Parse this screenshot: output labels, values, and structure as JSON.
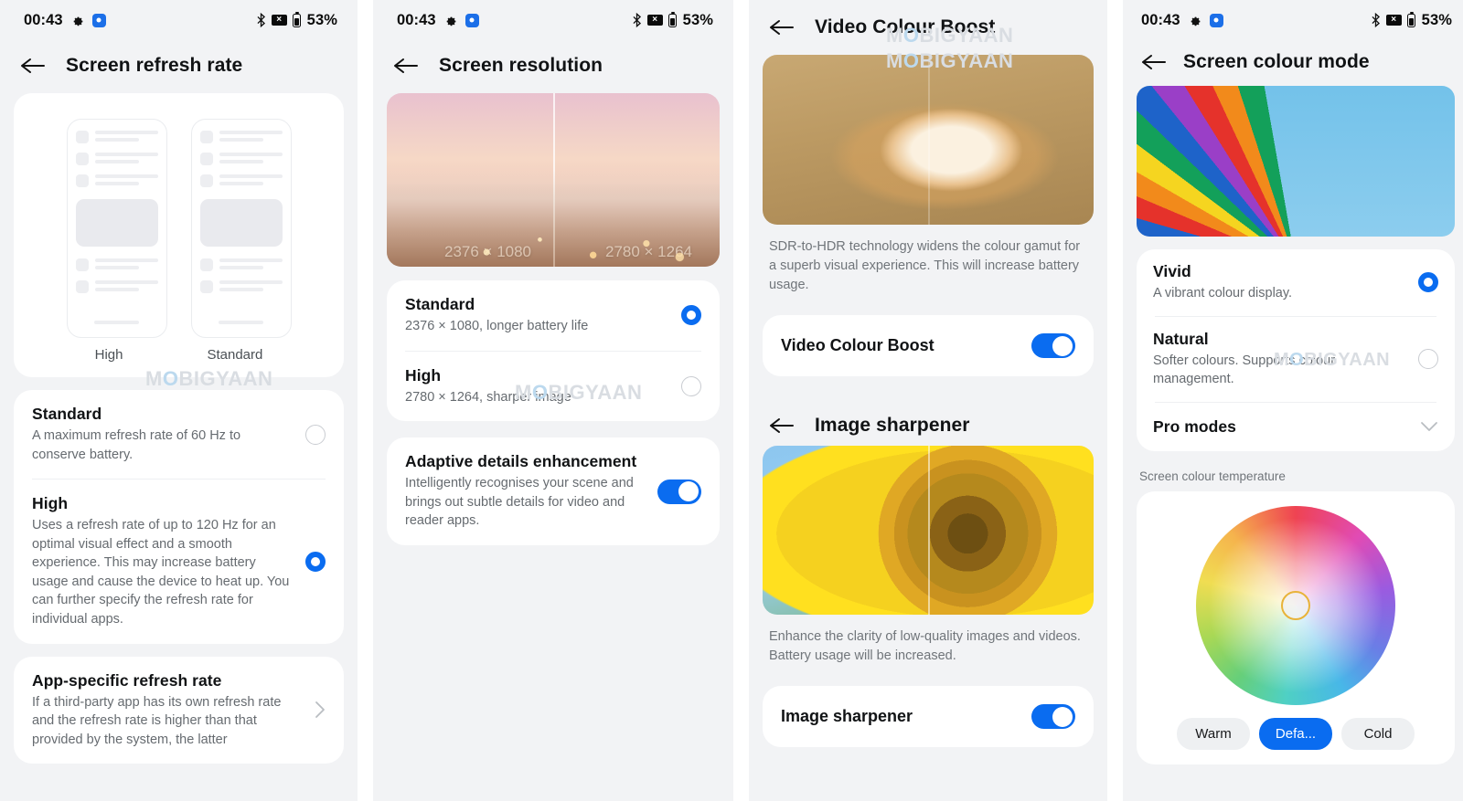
{
  "status_bar": {
    "time": "00:43",
    "battery_percent": "53%",
    "icons": [
      "gear-icon",
      "blue-indicator-icon",
      "bluetooth-icon",
      "sms-blocked-icon",
      "battery-icon"
    ]
  },
  "watermark": {
    "text": "MOBIGYAAN",
    "pre": "M",
    "o": "O",
    "post": "BIGYAAN"
  },
  "colors": {
    "accent_blue": "#0a6cf0",
    "page_bg": "#f2f3f5",
    "card_bg": "#ffffff",
    "subtext": "#70757a",
    "knob_ring": "#e8b339"
  },
  "panels": [
    {
      "id": "screen-refresh-rate",
      "title": "Screen refresh rate",
      "illustration": {
        "left_label": "High",
        "right_label": "Standard"
      },
      "options": [
        {
          "title": "Standard",
          "subtitle": "A maximum refresh rate of 60 Hz to conserve battery.",
          "selected": false
        },
        {
          "title": "High",
          "subtitle": "Uses a refresh rate of up to 120 Hz for an optimal visual effect and a smooth experience. This may increase battery usage and cause the device to heat up. You can further specify the refresh rate for individual apps.",
          "selected": true
        }
      ],
      "link_row": {
        "title": "App-specific refresh rate",
        "subtitle": "If a third-party app has its own refresh rate and the refresh rate is higher than that provided by the system, the latter"
      }
    },
    {
      "id": "screen-resolution",
      "title": "Screen resolution",
      "hero_labels": {
        "left": "2376 × 1080",
        "right": "2780 × 1264"
      },
      "options": [
        {
          "title": "Standard",
          "subtitle": "2376 × 1080, longer battery life",
          "selected": true
        },
        {
          "title": "High",
          "subtitle": "2780 × 1264, sharper image",
          "selected": false
        }
      ],
      "toggle_row": {
        "title": "Adaptive details enhancement",
        "subtitle": "Intelligently recognises your scene and brings out subtle details for video and reader apps.",
        "on": true
      }
    },
    {
      "id": "video-colour-boost",
      "title": "Video Colour Boost",
      "description": "SDR-to-HDR technology widens the colour gamut for a superb visual experience. This will increase battery usage.",
      "toggle_row": {
        "title": "Video Colour Boost",
        "on": true
      },
      "second": {
        "title": "Image sharpener",
        "description": "Enhance the clarity of low-quality images and videos. Battery usage will be increased.",
        "toggle_row": {
          "title": "Image sharpener",
          "on": true
        }
      }
    },
    {
      "id": "screen-colour-mode",
      "title": "Screen colour mode",
      "options": [
        {
          "title": "Vivid",
          "subtitle": "A vibrant colour display.",
          "selected": true
        },
        {
          "title": "Natural",
          "subtitle": "Softer colours. Supports colour management.",
          "selected": false
        }
      ],
      "pro_modes": {
        "title": "Pro modes"
      },
      "temperature": {
        "section_label": "Screen colour temperature",
        "buttons": [
          {
            "label": "Warm",
            "active": false
          },
          {
            "label": "Defa...",
            "active": true
          },
          {
            "label": "Cold",
            "active": false
          }
        ]
      }
    }
  ]
}
